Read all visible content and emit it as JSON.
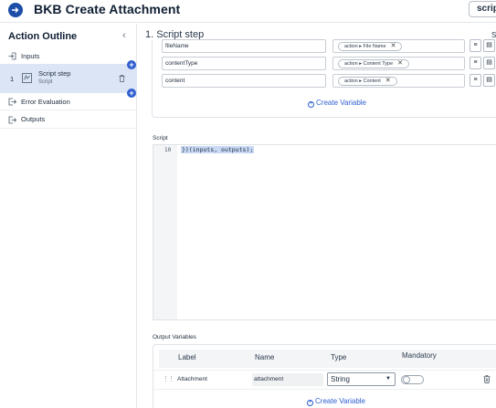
{
  "header": {
    "title": "BKB Create Attachment",
    "script_button": "script"
  },
  "sidebar": {
    "title": "Action Outline",
    "items": [
      {
        "label": "Inputs"
      },
      {
        "number": "1",
        "label": "Script step",
        "sublabel": "Script"
      },
      {
        "label": "Error Evaluation"
      },
      {
        "label": "Outputs"
      }
    ]
  },
  "main": {
    "step_title": "1.  Script step",
    "step_title_right": "S",
    "input_variables": [
      {
        "name": "fileName",
        "pill_parent": "action",
        "pill_field": "File Name"
      },
      {
        "name": "contentType",
        "pill_parent": "action",
        "pill_field": "Content Type"
      },
      {
        "name": "content",
        "pill_parent": "action",
        "pill_field": "Content"
      }
    ],
    "create_variable_label": "Create Variable",
    "script": {
      "label": "Script",
      "line_number": "10",
      "code": "})(inputs, outputs);"
    },
    "output_variables": {
      "label": "Output Variables",
      "columns": [
        "Label",
        "Name",
        "Type",
        "Mandatory"
      ],
      "rows": [
        {
          "label": "Attachment",
          "name": "attachment",
          "type": "String",
          "mandatory": false
        }
      ],
      "create_variable_label": "Create Variable"
    }
  },
  "colors": {
    "accent": "#2f5fd0",
    "selected_row": "#dbe5f6",
    "code_highlight": "#c8d8f5"
  }
}
